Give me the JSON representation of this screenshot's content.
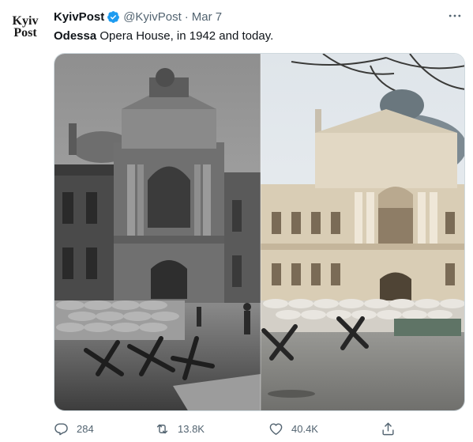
{
  "avatar": {
    "line1": "Kyiv",
    "line2": "Post"
  },
  "tweet": {
    "author_name": "KyivPost",
    "handle": "@KyivPost",
    "separator": "·",
    "date": "Mar 7",
    "text_bold": "Odessa",
    "text_rest": " Opera House, in 1942 and today."
  },
  "media": {
    "description": "Split photo of the Odessa Opera House: black-and-white 1942 on the left, color present-day on the right, sandbags and anti-tank hedgehogs in front"
  },
  "actions": {
    "replies": "284",
    "retweets": "13.8K",
    "likes": "40.4K"
  },
  "colors": {
    "verified": "#1d9bf0",
    "muted": "#536471"
  },
  "icons": [
    "verified-badge-icon",
    "more-icon",
    "reply-icon",
    "retweet-icon",
    "like-icon",
    "share-icon"
  ]
}
